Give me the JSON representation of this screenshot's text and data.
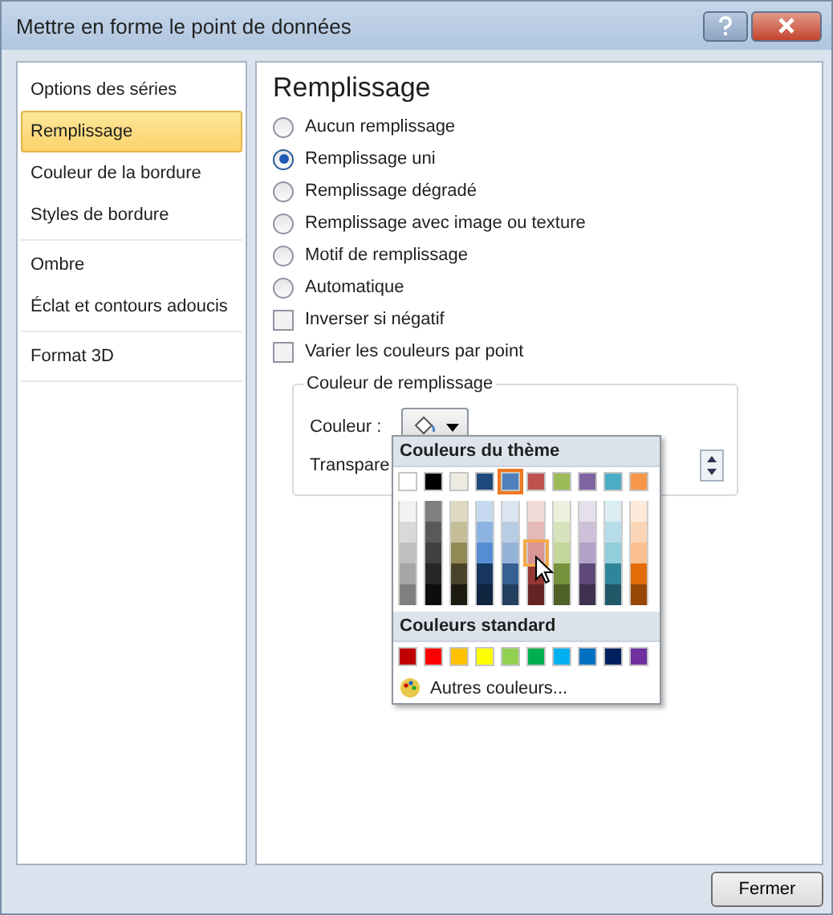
{
  "window": {
    "title": "Mettre en forme le point de données"
  },
  "sidebar": {
    "groups": [
      [
        {
          "label": "Options des séries",
          "selected": false
        },
        {
          "label": "Remplissage",
          "selected": true
        },
        {
          "label": "Couleur de la bordure",
          "selected": false
        },
        {
          "label": "Styles de bordure",
          "selected": false
        }
      ],
      [
        {
          "label": "Ombre",
          "selected": false
        },
        {
          "label": "Éclat et contours adoucis",
          "selected": false
        }
      ],
      [
        {
          "label": "Format 3D",
          "selected": false
        }
      ]
    ]
  },
  "panel": {
    "heading": "Remplissage",
    "options": [
      {
        "kind": "radio",
        "label": "Aucun remplissage",
        "selected": false
      },
      {
        "kind": "radio",
        "label": "Remplissage uni",
        "selected": true
      },
      {
        "kind": "radio",
        "label": "Remplissage dégradé",
        "selected": false
      },
      {
        "kind": "radio",
        "label": "Remplissage avec image ou texture",
        "selected": false
      },
      {
        "kind": "radio",
        "label": "Motif de remplissage",
        "selected": false
      },
      {
        "kind": "radio",
        "label": "Automatique",
        "selected": false
      },
      {
        "kind": "checkbox",
        "label": "Inverser si négatif",
        "checked": false
      },
      {
        "kind": "checkbox",
        "label": "Varier les couleurs par point",
        "checked": false
      }
    ],
    "fill_group": {
      "title": "Couleur de remplissage",
      "color_label": "Couleur :",
      "transparency_label": "Transpare"
    }
  },
  "color_menu": {
    "theme_heading": "Couleurs du thème",
    "theme_colors": [
      {
        "color": "#ffffff",
        "selected": false,
        "shades": [
          {
            "color": "#f2f2f2",
            "hovered": false
          },
          {
            "color": "#d9d9d9",
            "hovered": false
          },
          {
            "color": "#bfbfbf",
            "hovered": false
          },
          {
            "color": "#a6a6a6",
            "hovered": false
          },
          {
            "color": "#808080",
            "hovered": false
          }
        ]
      },
      {
        "color": "#000000",
        "selected": false,
        "shades": [
          {
            "color": "#7f7f7f",
            "hovered": false
          },
          {
            "color": "#595959",
            "hovered": false
          },
          {
            "color": "#404040",
            "hovered": false
          },
          {
            "color": "#262626",
            "hovered": false
          },
          {
            "color": "#0d0d0d",
            "hovered": false
          }
        ]
      },
      {
        "color": "#eeece1",
        "selected": false,
        "shades": [
          {
            "color": "#ddd9c3",
            "hovered": false
          },
          {
            "color": "#c4bd97",
            "hovered": false
          },
          {
            "color": "#938953",
            "hovered": false
          },
          {
            "color": "#494429",
            "hovered": false
          },
          {
            "color": "#1d1b10",
            "hovered": false
          }
        ]
      },
      {
        "color": "#1f497d",
        "selected": false,
        "shades": [
          {
            "color": "#c6d9f0",
            "hovered": false
          },
          {
            "color": "#8db3e2",
            "hovered": false
          },
          {
            "color": "#548dd4",
            "hovered": false
          },
          {
            "color": "#17365d",
            "hovered": false
          },
          {
            "color": "#0f243e",
            "hovered": false
          }
        ]
      },
      {
        "color": "#4f81bd",
        "selected": true,
        "shades": [
          {
            "color": "#dbe5f1",
            "hovered": false
          },
          {
            "color": "#b8cce4",
            "hovered": false
          },
          {
            "color": "#95b3d7",
            "hovered": false
          },
          {
            "color": "#366092",
            "hovered": false
          },
          {
            "color": "#244061",
            "hovered": false
          }
        ]
      },
      {
        "color": "#c0504d",
        "selected": false,
        "shades": [
          {
            "color": "#f2dcdb",
            "hovered": false
          },
          {
            "color": "#e5b9b7",
            "hovered": false
          },
          {
            "color": "#d99694",
            "hovered": true
          },
          {
            "color": "#953734",
            "hovered": false
          },
          {
            "color": "#632423",
            "hovered": false
          }
        ]
      },
      {
        "color": "#9bbb59",
        "selected": false,
        "shades": [
          {
            "color": "#ebf1dd",
            "hovered": false
          },
          {
            "color": "#d7e3bc",
            "hovered": false
          },
          {
            "color": "#c3d69b",
            "hovered": false
          },
          {
            "color": "#76923c",
            "hovered": false
          },
          {
            "color": "#4f6128",
            "hovered": false
          }
        ]
      },
      {
        "color": "#8064a2",
        "selected": false,
        "shades": [
          {
            "color": "#e5e0ec",
            "hovered": false
          },
          {
            "color": "#ccc1d9",
            "hovered": false
          },
          {
            "color": "#b2a2c7",
            "hovered": false
          },
          {
            "color": "#5f497a",
            "hovered": false
          },
          {
            "color": "#3f3151",
            "hovered": false
          }
        ]
      },
      {
        "color": "#4bacc6",
        "selected": false,
        "shades": [
          {
            "color": "#dbeef3",
            "hovered": false
          },
          {
            "color": "#b7dde8",
            "hovered": false
          },
          {
            "color": "#92cddc",
            "hovered": false
          },
          {
            "color": "#31859b",
            "hovered": false
          },
          {
            "color": "#205867",
            "hovered": false
          }
        ]
      },
      {
        "color": "#f79646",
        "selected": false,
        "shades": [
          {
            "color": "#fdeada",
            "hovered": false
          },
          {
            "color": "#fbd5b5",
            "hovered": false
          },
          {
            "color": "#fac08f",
            "hovered": false
          },
          {
            "color": "#e36c09",
            "hovered": false
          },
          {
            "color": "#974806",
            "hovered": false
          }
        ]
      }
    ],
    "standard_heading": "Couleurs standard",
    "standard_colors": [
      {
        "color": "#c00000"
      },
      {
        "color": "#ff0000"
      },
      {
        "color": "#ffc000"
      },
      {
        "color": "#ffff00"
      },
      {
        "color": "#92d050"
      },
      {
        "color": "#00b050"
      },
      {
        "color": "#00b0f0"
      },
      {
        "color": "#0070c0"
      },
      {
        "color": "#002060"
      },
      {
        "color": "#7030a0"
      }
    ],
    "more_label": "Autres couleurs..."
  },
  "buttons": [
    "Fermer"
  ]
}
